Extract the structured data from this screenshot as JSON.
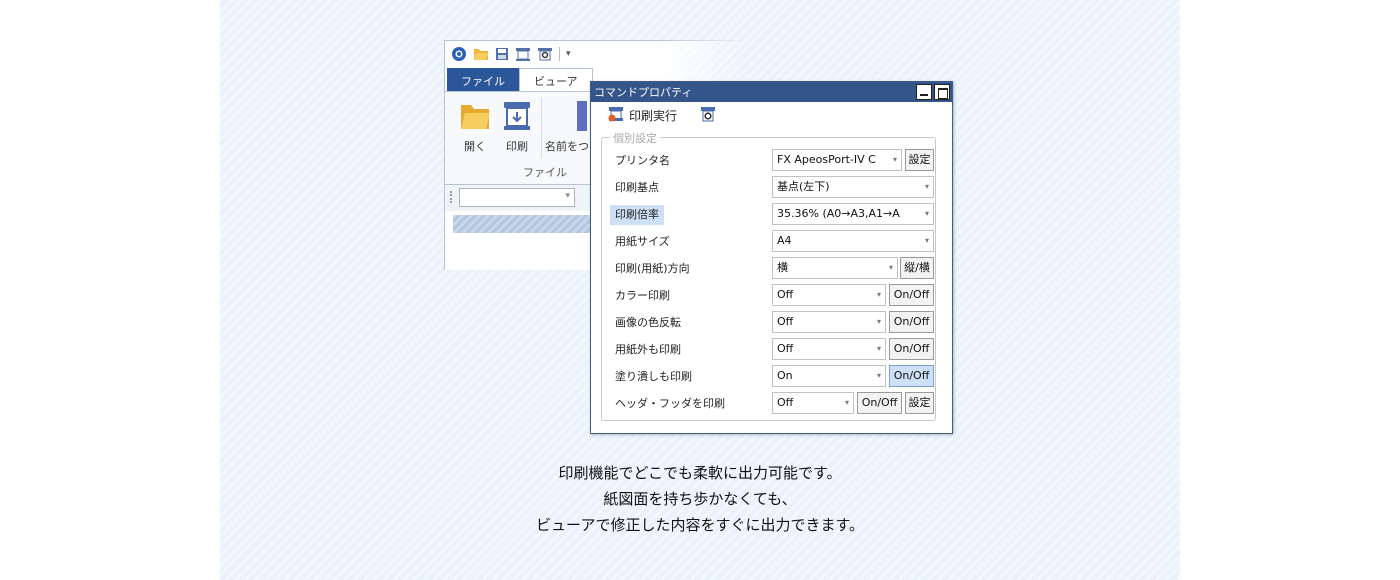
{
  "app": {
    "tabs": [
      "ファイル",
      "ビューア"
    ],
    "ribbon_buttons": [
      "開く",
      "印刷",
      "名前をつ"
    ],
    "group_label": "ファイル"
  },
  "dialog": {
    "title": "コマンドプロパティ",
    "toolbar_print": "印刷実行",
    "fieldset_legend": "個別設定",
    "rows": [
      {
        "label": "プリンタ名",
        "value": "FX ApeosPort-IV C",
        "button": "設定"
      },
      {
        "label": "印刷基点",
        "value": "基点(左下)",
        "button": ""
      },
      {
        "label": "印刷倍率",
        "value": "35.36% (A0→A3,A1→A",
        "button": ""
      },
      {
        "label": "用紙サイズ",
        "value": "A4",
        "button": ""
      },
      {
        "label": "印刷(用紙)方向",
        "value": "横",
        "button": "縦/横"
      },
      {
        "label": "カラー印刷",
        "value": "Off",
        "button": "On/Off"
      },
      {
        "label": "画像の色反転",
        "value": "Off",
        "button": "On/Off"
      },
      {
        "label": "用紙外も印刷",
        "value": "Off",
        "button": "On/Off"
      },
      {
        "label": "塗り潰しも印刷",
        "value": "On",
        "button": "On/Off"
      },
      {
        "label": "ヘッダ・フッダを印刷",
        "value": "Off",
        "button": "On/Off",
        "button2": "設定"
      }
    ]
  },
  "caption": [
    "印刷機能でどこでも柔軟に出力可能です。",
    "紙図面を持ち歩かなくても、",
    "ビューアで修正した内容をすぐに出力できます。"
  ],
  "colors": {
    "accent": "#2b579a",
    "titlebar": "#34558a",
    "highlight": "#cde0f5",
    "panel": "#eaf2fb"
  },
  "icons": [
    "app-logo-icon",
    "open-folder-icon",
    "save-icon",
    "print-icon",
    "print-preview-icon"
  ]
}
